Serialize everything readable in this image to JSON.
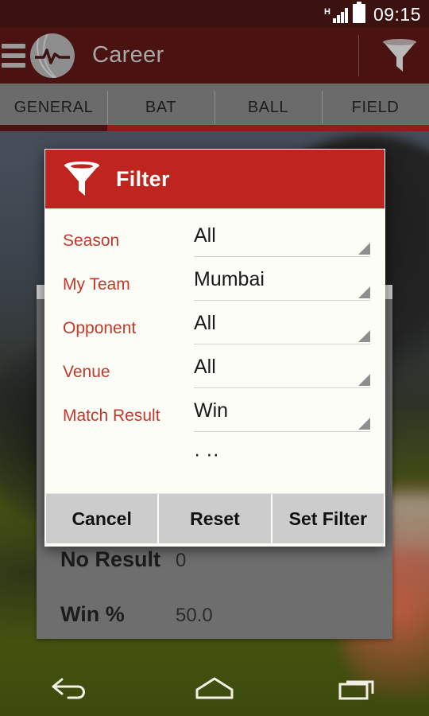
{
  "status_bar": {
    "network_type": "H",
    "time": "09:15"
  },
  "app_bar": {
    "menu_icon": "hamburger-menu-icon",
    "logo_icon": "cricket-pulse-logo-icon",
    "title": "Career",
    "filter_icon": "funnel-filter-icon"
  },
  "tabs": [
    {
      "label": "GENERAL",
      "active": true
    },
    {
      "label": "BAT",
      "active": false
    },
    {
      "label": "BALL",
      "active": false
    },
    {
      "label": "FIELD",
      "active": false
    }
  ],
  "background_card": {
    "rows": [
      {
        "label": "No Result",
        "value": "0"
      },
      {
        "label": "Win %",
        "value": "50.0"
      }
    ]
  },
  "dialog": {
    "icon": "funnel-filter-icon",
    "title": "Filter",
    "fields": [
      {
        "label": "Season",
        "value": "All"
      },
      {
        "label": "My Team",
        "value": "Mumbai"
      },
      {
        "label": "Opponent",
        "value": "All"
      },
      {
        "label": "Venue",
        "value": "All"
      },
      {
        "label": "Match Result",
        "value": "Win"
      },
      {
        "label": ".",
        "value": "· ··"
      }
    ],
    "buttons": [
      {
        "label": "Cancel"
      },
      {
        "label": "Reset"
      },
      {
        "label": "Set Filter"
      }
    ]
  },
  "nav_bar": {
    "back_icon": "back-arrow-icon",
    "home_icon": "home-icon",
    "recents_icon": "recent-apps-icon"
  },
  "colors": {
    "app_bar": "#4a1210",
    "status_bar": "#3b120f",
    "accent_red": "#c0241f",
    "label_red": "#c0392b",
    "tab_bar": "#6b6b6b",
    "dialog_bg": "#fdfdf8",
    "button_bg": "#cccccc"
  }
}
